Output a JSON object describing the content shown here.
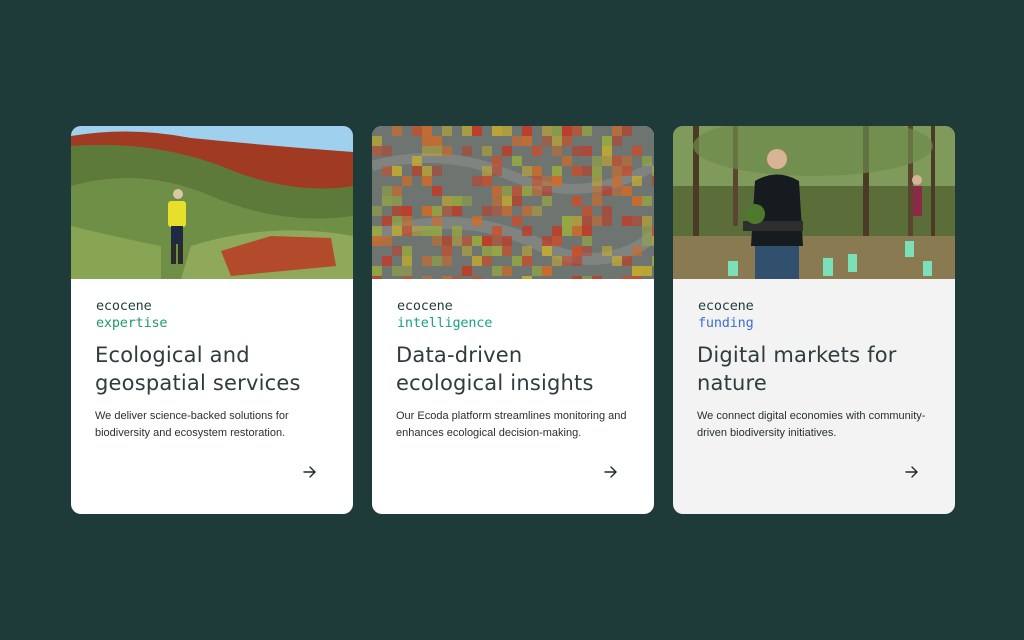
{
  "cards": [
    {
      "brand": "ecocene",
      "product": "expertise",
      "product_color": "#1f9a6a",
      "title": "Ecological and geospatial services",
      "description": "We deliver science-backed solutions for biodiversity and ecosystem restoration.",
      "image": "outback-surveyor-photo",
      "arrow_icon": "arrow-right-icon"
    },
    {
      "brand": "ecocene",
      "product": "intelligence",
      "product_color": "#19a08a",
      "title": "Data-driven ecological insights",
      "description": "Our Ecoda platform streamlines monitoring and enhances ecological decision-making.",
      "image": "geospatial-heatmap-image",
      "arrow_icon": "arrow-right-icon"
    },
    {
      "brand": "ecocene",
      "product": "funding",
      "product_color": "#3a6fd6",
      "title": "Digital markets for nature",
      "description": "We connect digital economies with community-driven biodiversity initiatives.",
      "image": "tree-planting-photo",
      "arrow_icon": "arrow-right-icon"
    }
  ]
}
